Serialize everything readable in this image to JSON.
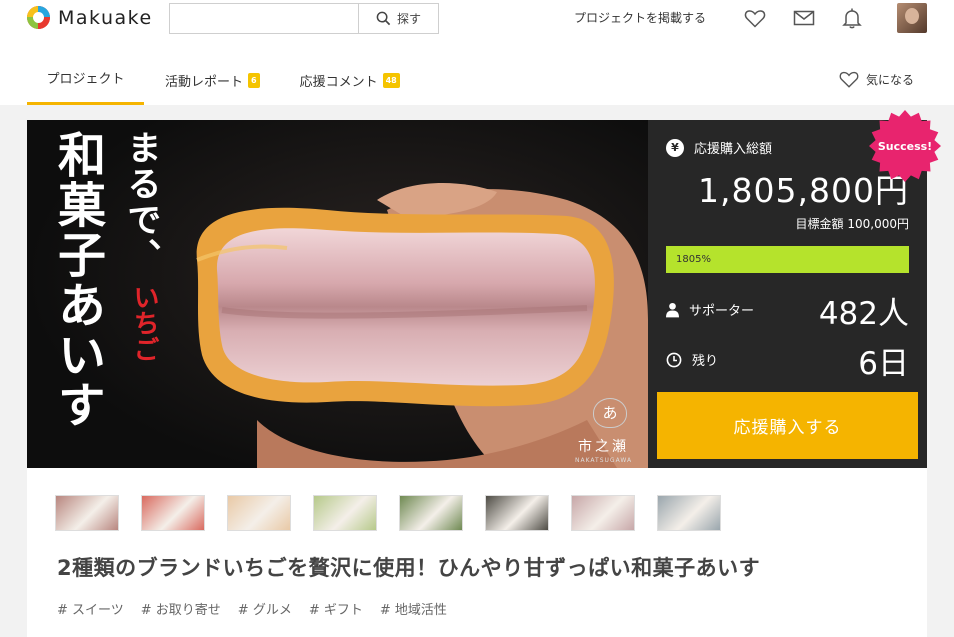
{
  "header": {
    "logo_text": "Makuake",
    "search_placeholder": "",
    "search_button": "探す",
    "post_link": "プロジェクトを掲載する"
  },
  "tabs": [
    {
      "label": "プロジェクト",
      "badge": ""
    },
    {
      "label": "活動レポート",
      "badge": "6"
    },
    {
      "label": "応援コメント",
      "badge": "48"
    }
  ],
  "watch_label": "気になる",
  "hero": {
    "vertical_main": "和菓子あいす",
    "vertical_sub": "まるで、",
    "vertical_red": "いちご",
    "brand_mark": "あ",
    "brand_jp": "市之瀬",
    "brand_en": "NAKATSUGAWA"
  },
  "stats": {
    "yen_icon": "¥",
    "total_label": "応援購入総額",
    "total_value": "1,805,800円",
    "goal": "目標金額 100,000円",
    "progress_text": "1805%",
    "progress_fraction": 1.0,
    "supporters_label": "サポーター",
    "supporters_value": "482人",
    "remaining_label": "残り",
    "remaining_value": "6日",
    "cta": "応援購入する",
    "success_badge": "Success!"
  },
  "thumbnails": [
    {
      "color": "#b8867f"
    },
    {
      "color": "#d96a5f"
    },
    {
      "color": "#e9c9a6"
    },
    {
      "color": "#b6c98a"
    },
    {
      "color": "#6f8a52"
    },
    {
      "color": "#4e4c45"
    },
    {
      "color": "#c7a7a8"
    },
    {
      "color": "#9aa6ad"
    }
  ],
  "project_title": "2種類のブランドいちごを贅沢に使用！ひんやり甘ずっぱい和菓子あいす",
  "tags": [
    "# スイーツ",
    "# お取り寄せ",
    "# グルメ",
    "# ギフト",
    "# 地域活性"
  ],
  "colors": {
    "accent": "#f5b400",
    "progress": "#b5e32c",
    "success": "#e8246e",
    "panel": "#272727"
  }
}
